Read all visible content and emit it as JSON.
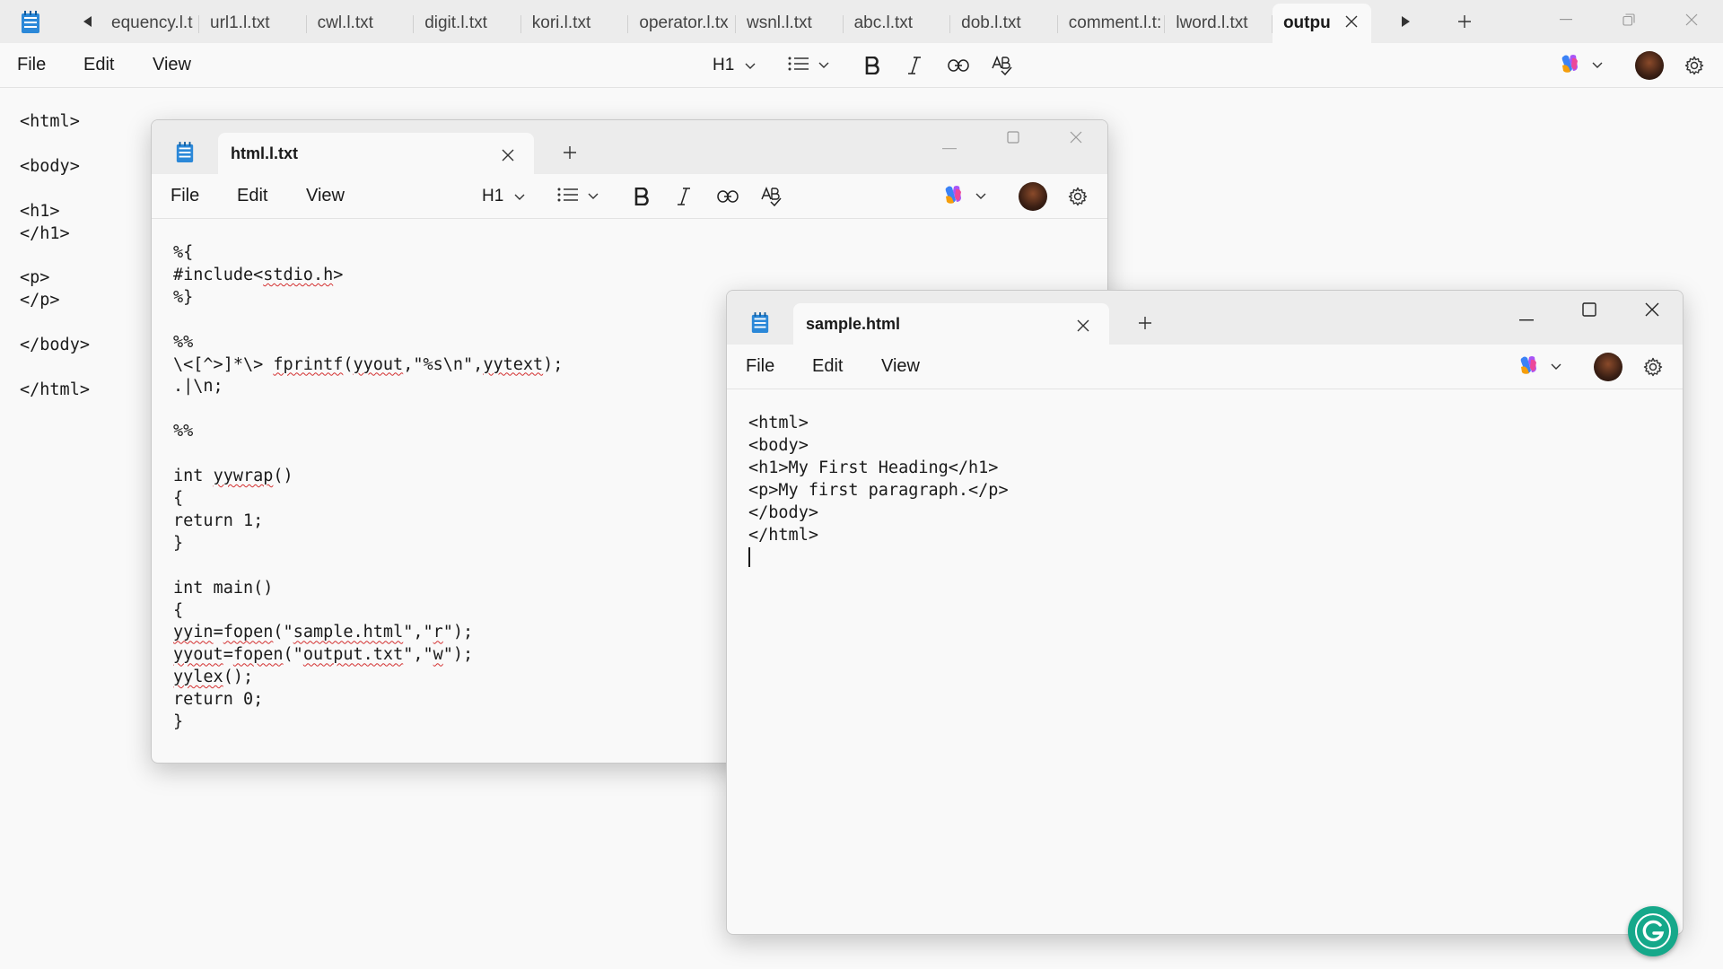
{
  "main_window": {
    "tabs": [
      "equency.l.t",
      "url1.l.txt",
      "cwl.l.txt",
      "digit.l.txt",
      "kori.l.txt",
      "operator.l.tx",
      "wsnl.l.txt",
      "abc.l.txt",
      "dob.l.txt",
      "comment.l.t:",
      "lword.l.txt",
      "outpu"
    ],
    "menu": {
      "file": "File",
      "edit": "Edit",
      "view": "View"
    },
    "heading_label": "H1",
    "content": "<html>\n\n<body>\n\n<h1>\n</h1>\n\n<p>\n</p>\n\n</body>\n\n</html>"
  },
  "html_window": {
    "tab_label": "html.l.txt",
    "menu": {
      "file": "File",
      "edit": "Edit",
      "view": "View"
    },
    "heading_label": "H1"
  },
  "sample_window": {
    "tab_label": "sample.html",
    "menu": {
      "file": "File",
      "edit": "Edit",
      "view": "View"
    },
    "content": "<html>\n<body>\n<h1>My First Heading</h1>\n<p>My first paragraph.</p>\n</body>\n</html>"
  },
  "colors": {
    "accent": "#0f6cbd",
    "grammarly": "#15a88a",
    "spell_underline": "#d32f2f"
  },
  "icons": [
    "notepad-icon",
    "chevron-down-icon",
    "list-icon",
    "bold-icon",
    "italic-icon",
    "link-icon",
    "spellcheck-icon",
    "copilot-icon",
    "gear-icon",
    "close-icon",
    "plus-icon",
    "minimize-icon",
    "maximize-icon",
    "restore-icon"
  ]
}
